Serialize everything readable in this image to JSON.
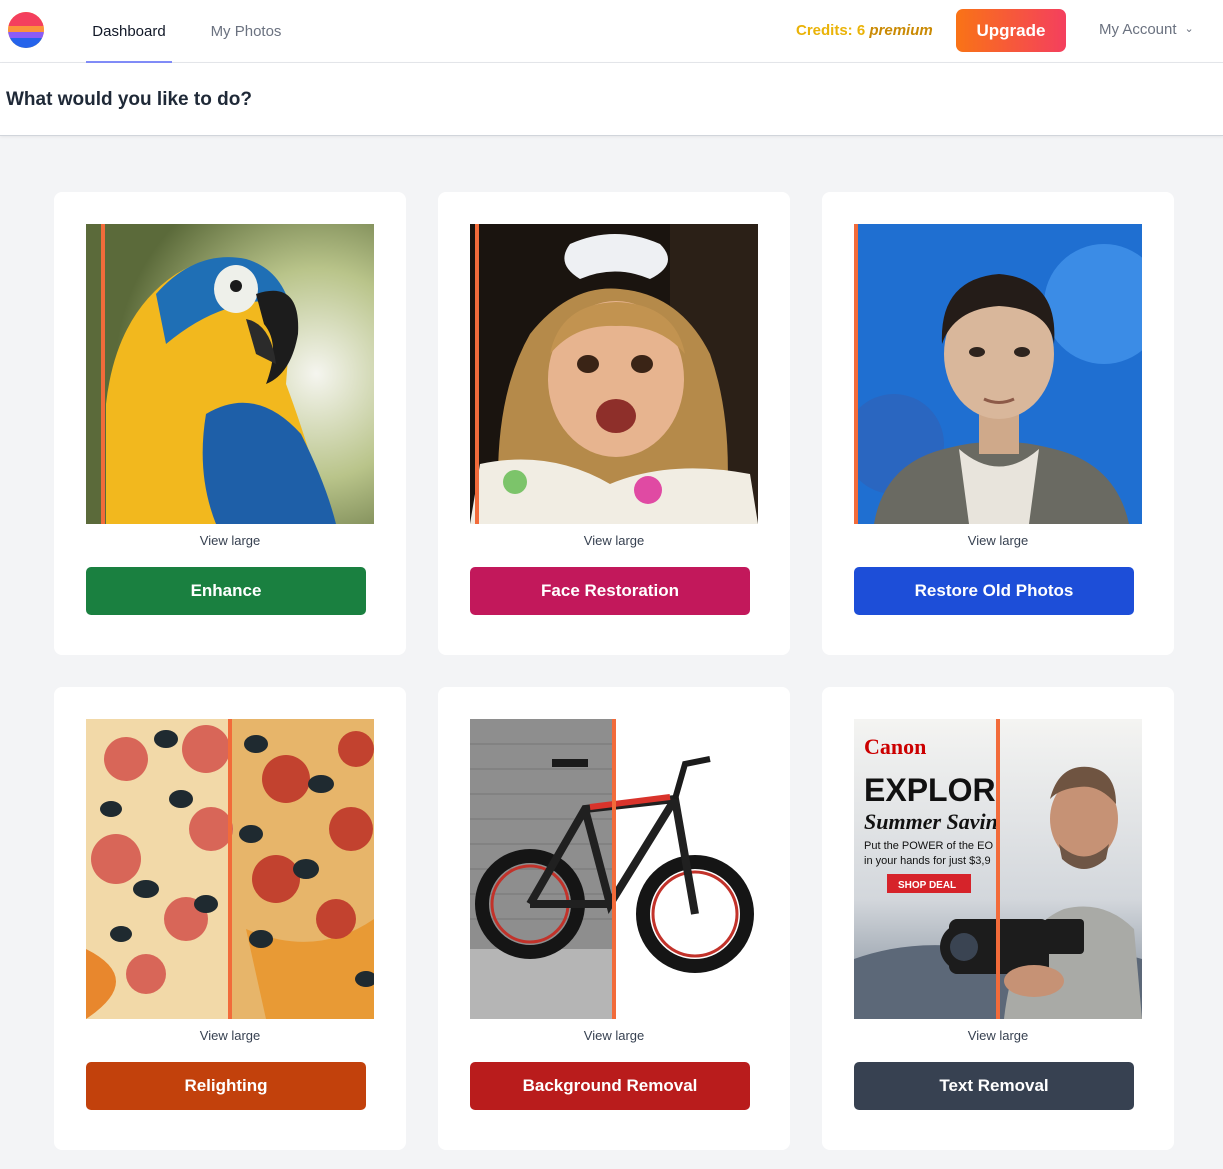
{
  "nav": {
    "tabs": [
      {
        "label": "Dashboard",
        "active": true
      },
      {
        "label": "My Photos",
        "active": false
      }
    ],
    "credits_label": "Credits: 6",
    "credits_plan": "premium",
    "upgrade_label": "Upgrade",
    "account_label": "My Account"
  },
  "page": {
    "heading": "What would you like to do?"
  },
  "cards": [
    {
      "image": "macaw-parrot-photo",
      "view_label": "View large",
      "button_label": "Enhance",
      "button_color": "#1a8040"
    },
    {
      "image": "smiling-girl-photo",
      "view_label": "View large",
      "button_label": "Face Restoration",
      "button_color": "#c2185b"
    },
    {
      "image": "vintage-boy-portrait",
      "view_label": "View large",
      "button_label": "Restore Old Photos",
      "button_color": "#1d4ed8"
    },
    {
      "image": "pepperoni-pizza-photo",
      "view_label": "View large",
      "button_label": "Relighting",
      "button_color": "#c2410c"
    },
    {
      "image": "mountain-bike-photo",
      "view_label": "View large",
      "button_label": "Background Removal",
      "button_color": "#b91c1c"
    },
    {
      "image": "canon-camera-ad-photo",
      "view_label": "View large",
      "button_label": "Text Removal",
      "button_color": "#374151"
    }
  ],
  "ad_text": {
    "brand": "Canon",
    "headline": "EXPLOR",
    "subhead": "Summer Savin",
    "line1": "Put the POWER of the EO",
    "line2": "in your hands for just $3,9",
    "cta": "SHOP DEAL"
  },
  "colors": {
    "accent_underline": "#818cf8",
    "compare_divider": "#f26b3a",
    "credits": "#eab308"
  }
}
